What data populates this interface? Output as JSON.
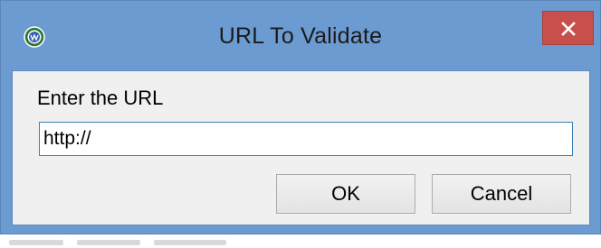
{
  "window": {
    "title": "URL To Validate",
    "icon": "url-globe-icon",
    "close_icon": "close-icon"
  },
  "form": {
    "prompt": "Enter the URL",
    "url_value": "http://"
  },
  "buttons": {
    "ok_label": "OK",
    "cancel_label": "Cancel"
  },
  "colors": {
    "title_bar": "#6b9bd1",
    "close_button": "#c7504c",
    "client_area": "#f0f0f0",
    "input_border": "#3c7fb1"
  }
}
